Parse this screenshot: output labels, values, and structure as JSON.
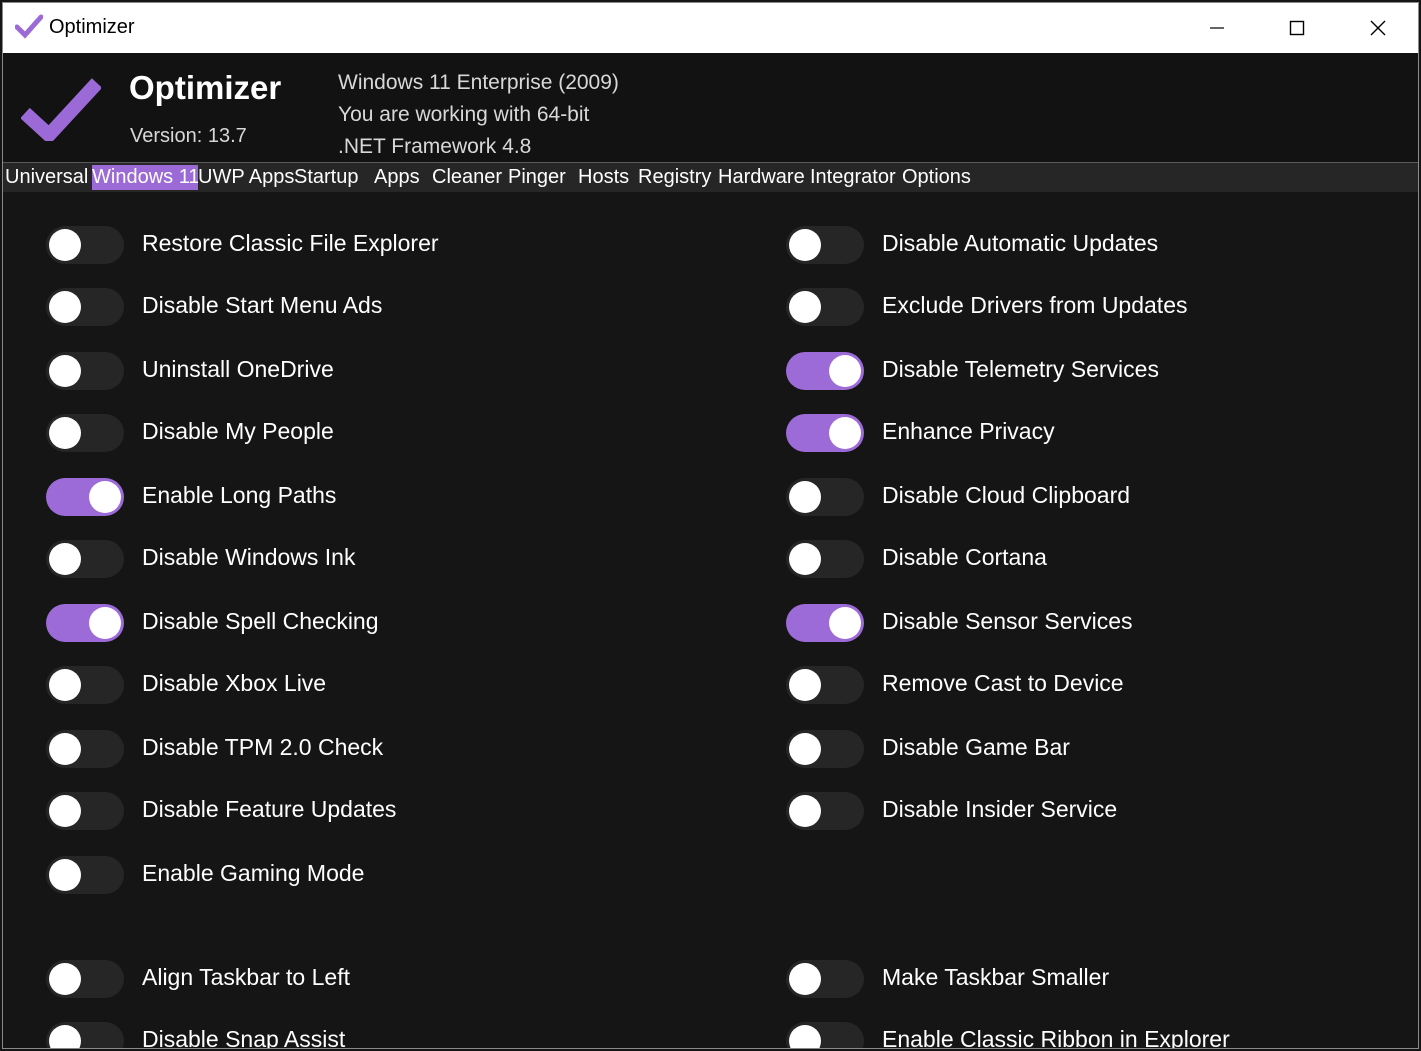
{
  "window": {
    "title": "Optimizer",
    "accent": "#9b6ad6"
  },
  "header": {
    "app_name": "Optimizer",
    "version": "Version: 13.7",
    "os_line": "Windows 11 Enterprise (2009)",
    "arch_line": "You are working with 64-bit",
    "framework_line": ".NET Framework 4.8"
  },
  "tabs": [
    {
      "label": "Universal",
      "active": false
    },
    {
      "label": "Windows 11",
      "active": true
    },
    {
      "label": "UWP Apps",
      "active": false
    },
    {
      "label": "Startup",
      "active": false
    },
    {
      "label": "Apps",
      "active": false
    },
    {
      "label": "Cleaner",
      "active": false
    },
    {
      "label": "Pinger",
      "active": false
    },
    {
      "label": "Hosts",
      "active": false
    },
    {
      "label": "Registry",
      "active": false
    },
    {
      "label": "Hardware",
      "active": false
    },
    {
      "label": "Integrator",
      "active": false
    },
    {
      "label": "Options",
      "active": false
    }
  ],
  "left_options": [
    {
      "label": "Restore Classic File Explorer",
      "on": false
    },
    {
      "label": "Disable Start Menu Ads",
      "on": false
    },
    {
      "label": "Uninstall OneDrive",
      "on": false
    },
    {
      "label": "Disable My People",
      "on": false
    },
    {
      "label": "Enable Long Paths",
      "on": true
    },
    {
      "label": "Disable Windows Ink",
      "on": false
    },
    {
      "label": "Disable Spell Checking",
      "on": true
    },
    {
      "label": "Disable Xbox Live",
      "on": false
    },
    {
      "label": "Disable TPM 2.0 Check",
      "on": false
    },
    {
      "label": "Disable Feature Updates",
      "on": false
    },
    {
      "label": "Enable Gaming Mode",
      "on": false
    }
  ],
  "right_options": [
    {
      "label": "Disable Automatic Updates",
      "on": false
    },
    {
      "label": "Exclude Drivers from Updates",
      "on": false
    },
    {
      "label": "Disable Telemetry Services",
      "on": true
    },
    {
      "label": "Enhance Privacy",
      "on": true
    },
    {
      "label": "Disable Cloud Clipboard",
      "on": false
    },
    {
      "label": "Disable Cortana",
      "on": false
    },
    {
      "label": "Disable Sensor Services",
      "on": true
    },
    {
      "label": "Remove Cast to Device",
      "on": false
    },
    {
      "label": "Disable Game Bar",
      "on": false
    },
    {
      "label": "Disable Insider Service",
      "on": false
    }
  ],
  "taskbar_left": [
    {
      "label": "Align Taskbar to Left",
      "on": false
    },
    {
      "label": "Disable Snap Assist",
      "on": false
    }
  ],
  "taskbar_right": [
    {
      "label": "Make Taskbar Smaller",
      "on": false
    },
    {
      "label": "Enable Classic Ribbon in Explorer",
      "on": false
    }
  ]
}
